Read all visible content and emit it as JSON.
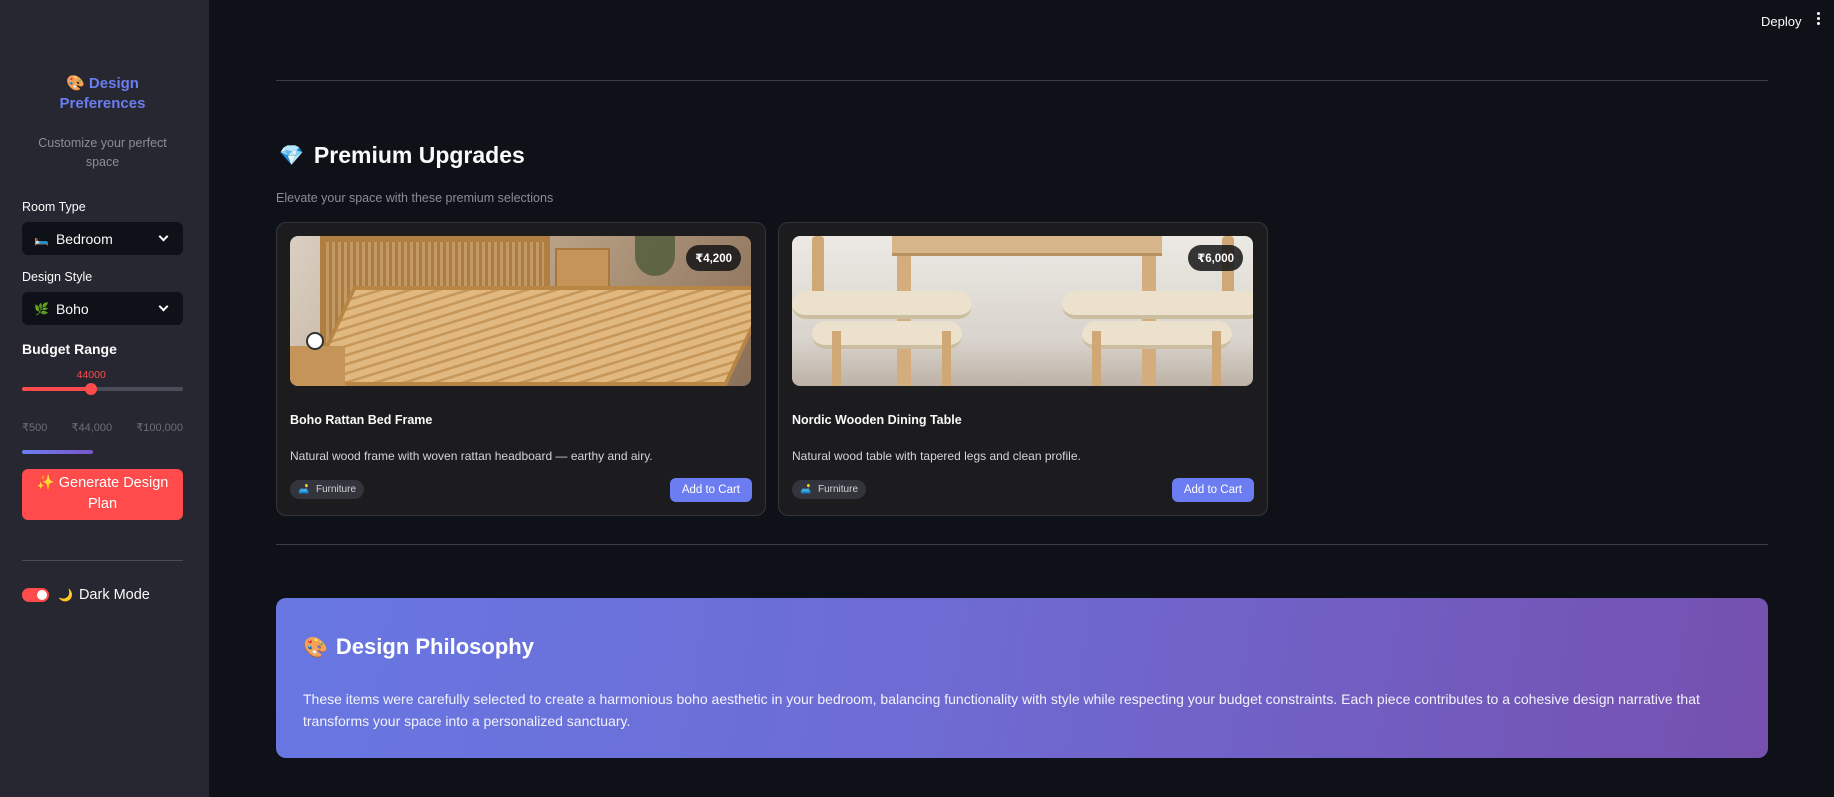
{
  "sidebar": {
    "title_emoji": "🎨",
    "title": "Design Preferences",
    "subtitle": "Customize your perfect space",
    "room_type": {
      "label": "Room Type",
      "emoji": "🛏️",
      "value": "Bedroom"
    },
    "design_style": {
      "label": "Design Style",
      "emoji": "🌿",
      "value": "Boho"
    },
    "budget": {
      "label": "Budget Range",
      "value": "44000",
      "fraction": 0.43,
      "min_label": "₹500",
      "current_label": "₹44,000",
      "max_label": "₹100,000"
    },
    "generate_button": "✨ Generate Design Plan",
    "dark_mode": {
      "emoji": "🌙",
      "label": "Dark Mode",
      "on": true
    }
  },
  "header": {
    "deploy": "Deploy"
  },
  "premium": {
    "emoji": "💎",
    "title": "Premium Upgrades",
    "subtitle": "Elevate your space with these premium selections",
    "items": [
      {
        "name": "Boho Rattan Bed Frame",
        "price": "₹4,200",
        "description": "Natural wood frame with woven rattan headboard — earthy and airy.",
        "tag_emoji": "🛋️",
        "tag": "Furniture",
        "button": "Add to Cart"
      },
      {
        "name": "Nordic Wooden Dining Table",
        "price": "₹6,000",
        "description": "Natural wood table with tapered legs and clean profile.",
        "tag_emoji": "🛋️",
        "tag": "Furniture",
        "button": "Add to Cart"
      }
    ]
  },
  "philosophy": {
    "emoji": "🎨",
    "title": "Design Philosophy",
    "text": "These items were carefully selected to create a harmonious boho aesthetic in your bedroom, balancing functionality with style while respecting your budget constraints. Each piece contributes to a cohesive design narrative that transforms your space into a personalized sanctuary."
  },
  "colors": {
    "accent": "#ff4b4b",
    "brand": "#6b7df0",
    "background": "#0e1117",
    "sidebar": "#262730"
  }
}
